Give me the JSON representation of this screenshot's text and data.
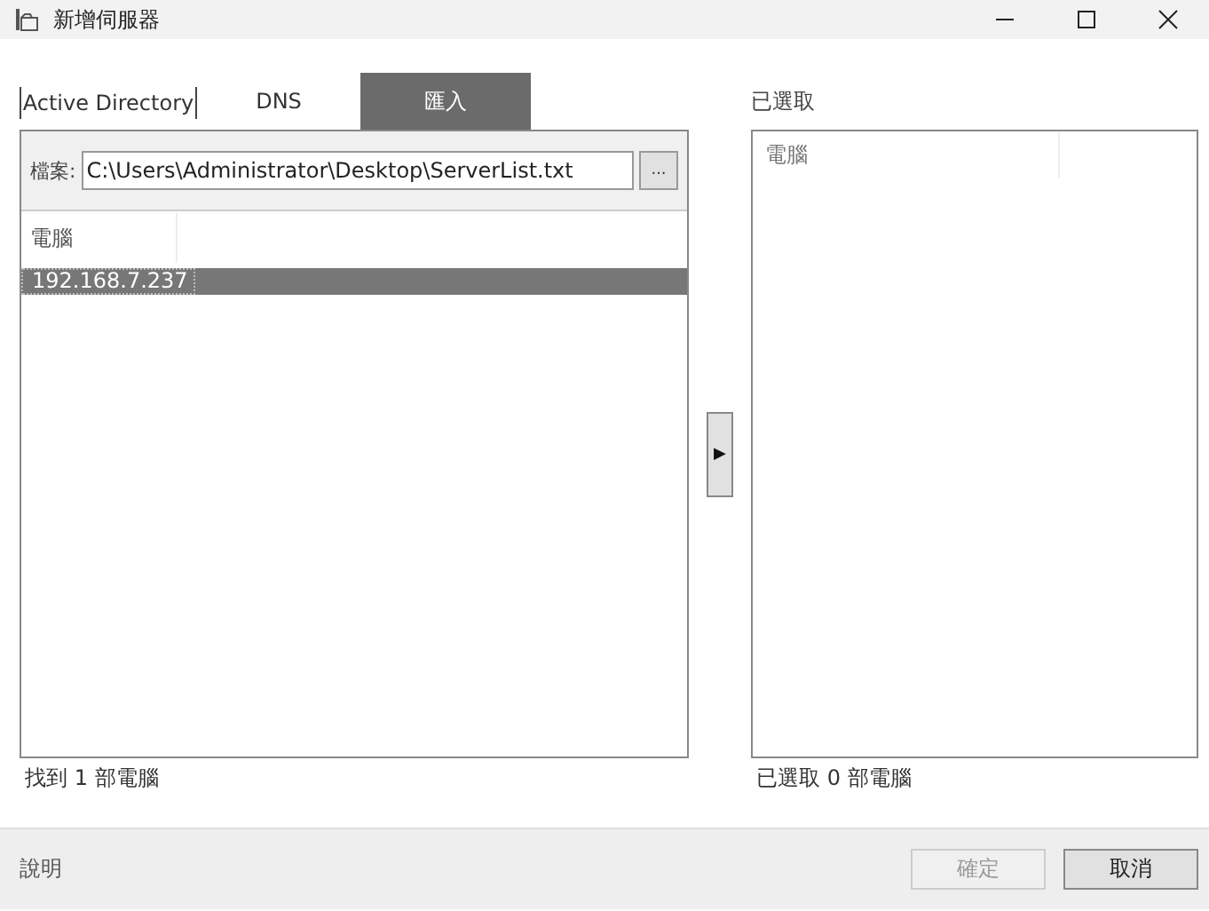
{
  "window": {
    "title": "新增伺服器"
  },
  "tabs": [
    {
      "label": "Active Directory",
      "selected": false
    },
    {
      "label": "DNS",
      "selected": false
    },
    {
      "label": "匯入",
      "selected": true
    }
  ],
  "file": {
    "label": "檔案:",
    "value": "C:\\Users\\Administrator\\Desktop\\ServerList.txt",
    "browse": "..."
  },
  "left_list": {
    "column": "電腦",
    "rows": [
      {
        "name": "192.168.7.237",
        "selected": true
      }
    ],
    "status": "找到 1 部電腦"
  },
  "add_button": "▶",
  "right_list": {
    "title": "已選取",
    "column": "電腦",
    "status": "已選取 0 部電腦"
  },
  "help": "說明",
  "buttons": [
    {
      "label": "確定",
      "disabled": true
    },
    {
      "label": "取消",
      "disabled": false
    }
  ]
}
